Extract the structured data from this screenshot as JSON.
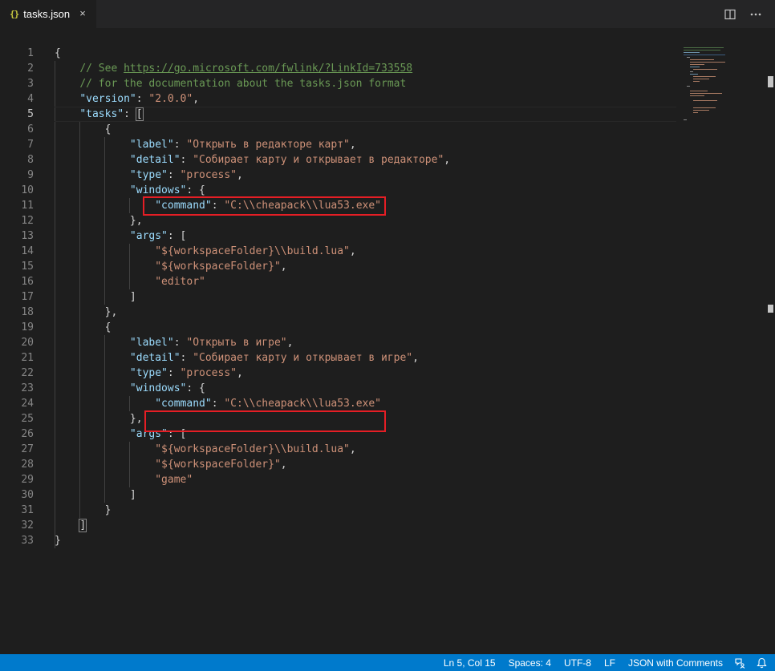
{
  "tab": {
    "icon": "{}",
    "label": "tasks.json",
    "close": "×"
  },
  "toolbar": {
    "split_icon": "split-editor-icon",
    "more_icon": "more-actions-icon"
  },
  "line_numbers": [
    "1",
    "2",
    "3",
    "4",
    "5",
    "6",
    "7",
    "8",
    "9",
    "10",
    "11",
    "12",
    "13",
    "14",
    "15",
    "16",
    "17",
    "18",
    "19",
    "20",
    "21",
    "22",
    "23",
    "24",
    "25",
    "26",
    "27",
    "28",
    "29",
    "30",
    "31",
    "32",
    "33"
  ],
  "code": {
    "l1_open": "{",
    "l2_comment": "// See ",
    "l2_link": "https://go.microsoft.com/fwlink/?LinkId=733558",
    "l3_comment": "// for the documentation about the tasks.json format",
    "version_key": "\"version\"",
    "version_value": "\"2.0.0\"",
    "tasks_key": "\"tasks\"",
    "open_bracket": "[",
    "close_bracket": "]",
    "open_brace": "{",
    "close_brace": "}",
    "close_brace_comma": "},",
    "close_bracket_plain": "]",
    "colon": ": ",
    "comma": ",",
    "colon_brace": ": {",
    "colon_bracket": ": [",
    "label_key": "\"label\"",
    "detail_key": "\"detail\"",
    "type_key": "\"type\"",
    "windows_key": "\"windows\"",
    "command_key": "\"command\"",
    "args_key": "\"args\"",
    "task1": {
      "label": "\"Открыть в редакторе карт\"",
      "detail": "\"Собирает карту и открывает в редакторе\"",
      "type": "\"process\"",
      "command": "\"C:\\\\cheapack\\\\lua53.exe\"",
      "args": [
        "\"${workspaceFolder}\\\\build.lua\"",
        "\"${workspaceFolder}\"",
        "\"editor\""
      ]
    },
    "task2": {
      "label": "\"Открыть в игре\"",
      "detail": "\"Собирает карту и открывает в игре\"",
      "type": "\"process\"",
      "command": "\"C:\\\\cheapack\\\\lua53.exe\"",
      "args": [
        "\"${workspaceFolder}\\\\build.lua\"",
        "\"${workspaceFolder}\"",
        "\"game\""
      ]
    }
  },
  "status": {
    "position": "Ln 5, Col 15",
    "spaces": "Spaces: 4",
    "encoding": "UTF-8",
    "eol": "LF",
    "language": "JSON with Comments",
    "feedback_icon": "feedback-icon",
    "bell_icon": "bell-icon"
  },
  "colors": {
    "accent": "#007acc",
    "highlight_box": "#e51e25",
    "key": "#9cdcfe",
    "string": "#ce9178",
    "comment": "#6a9955"
  }
}
